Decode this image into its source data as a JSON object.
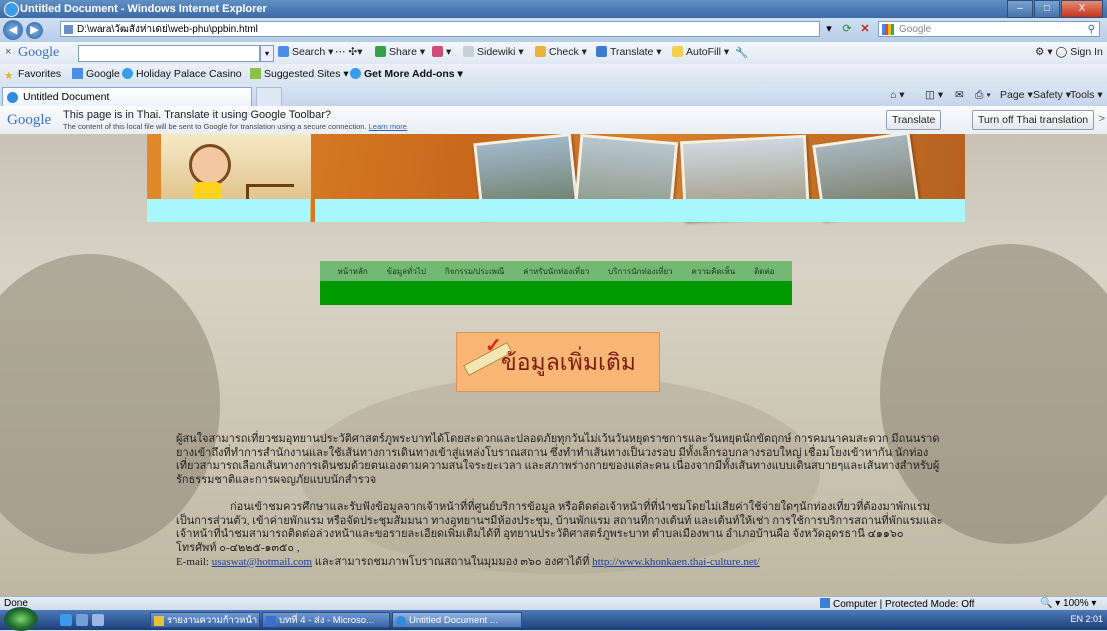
{
  "window": {
    "title": "Untitled Document - Windows Internet Explorer",
    "buttons": {
      "minimize": "–",
      "maximize": "□",
      "close": "X"
    }
  },
  "address_bar": {
    "url": "D:\\wara\\วัฒสังห่าเดย่\\web-phu\\ppbin.html",
    "search_placeholder": "Google",
    "back": "◀",
    "forward": "▶"
  },
  "google_toolbar": {
    "logo": "Google",
    "items": [
      "Search ▾",
      "Share ▾",
      "Sidewiki ▾",
      "Check ▾",
      "Translate ▾",
      "AutoFill ▾"
    ],
    "sign_in": "Sign In"
  },
  "favorites_bar": {
    "favorites": "Favorites",
    "items": [
      "Google",
      "Holiday Palace Casino",
      "Suggested Sites ▾",
      "Get More Add-ons ▾"
    ]
  },
  "tabs": {
    "active": "Untitled Document",
    "commands": [
      "Page ▾",
      "Safety ▾",
      "Tools ▾"
    ]
  },
  "translate_bar": {
    "logo": "Google",
    "message": "This page is in Thai.  Translate it using Google Toolbar?",
    "sub": "The content of this local file will be sent to Google for translation using a secure connection.",
    "learn_more": "Learn more",
    "translate_button": "Translate",
    "turn_off_button": "Turn off Thai translation",
    "close": ">"
  },
  "page": {
    "menu": [
      "หน้าหลัก",
      "ข้อมูลทั่วไป",
      "กิจกรรม/ประเพณี",
      "ค่าหรับนักท่องเที่ยว",
      "บริการนักท่องเที่ยว",
      "ความคิดเห็น",
      "ติดต่อ"
    ],
    "info_button": "ข้อมูลเพิ่มเติม",
    "paragraph1": "ผู้สนใจสามารถเที่ยวชมอุทยานประวัติศาสตร์ภูพระบาทได้โดยสะดวกและปลอดภัยทุกวันไม่เว้นวันหยุดราชการและวันหยุดนักขัตฤกษ์ การคมนาคมสะดวก มีถนนราดยางเข้าถึงที่ทำการสำนักงานและใช้เส้นทางการเดินทางเข้าสู่แหล่งโบราณสถาน ซึ่งทำทำเส้นทางเป็นวงรอบ มีทั้งเล็กรอบกลางรอบใหญ่ เชื่อมโยงเข้าหากัน นักท่องเที่ยวสามารถเลือกเส้นทางการเดินชมด้วยตนเองตามความสนใจระยะเวลา และสภาพร่างกายของแต่ละคน เนื่องจากมีทั้งเส้นทางแบบเดินสบายๆและเส้นทางสำหรับผู้รักธรรมชาติและการผจญภัยแบบนักสำรวจ",
    "paragraph2": "ก่อนเข้าชมควรศึกษาและรับฟังข้อมูลจากเจ้าหน้าที่ที่ศูนย์บริการข้อมูล หรือติดต่อเจ้าหน้าที่ที่นำชมโดยไม่เสียค่าใช้จ่ายใดๆนักท่องเที่ยวที่ต้องมาพักแรมเป็นการส่วนตัว, เข้าค่ายพักแรม หรือจัดประชุมสัมมนา ทางอุทยานฯมีห้องประชุม, บ้านพักแรม สถานที่กางเต้นท์ และเต้นท์ให้เช่า การใช้การบริการสถานที่พักแรมและเจ้าหน้าที่นำชมสามารถติดต่อล่วงหน้าและขอรายละเอียดเพิ่มเติมได้ที่ อุทยานประวัติศาสตร์ภูพระบาท ตำบลเมืองพาน อำเภอบ้านผือ จังหวัดอุดรธานี ๔๑๑๖๐ โทรศัพท์ ๐-๔๒๒๕-๑๓๕๐ ,",
    "email_prefix": "E-mail: ",
    "email": "usaswat@hotmail.com",
    "email_suffix": " และสามารถชมภาพโบราณสถานในมุมมอง ๓๖๐ องศาได้ที่ ",
    "link": "http://www.khonkaen.thai-culture.net/"
  },
  "status_bar": {
    "status": "Done",
    "zone": "Computer | Protected Mode: Off",
    "zoom": "100%"
  },
  "taskbar": {
    "items": [
      "รายงานความก้าวหน้า",
      "บทที่ 4 - ส่ง - Microso...",
      "Untitled Document ..."
    ],
    "tray": "EN  2:01"
  },
  "colors": {
    "menu_bg": "#73b873",
    "green_bar": "#009900",
    "cyan_bar": "#a8f7fb",
    "info_button_bg": "#f7b675"
  }
}
